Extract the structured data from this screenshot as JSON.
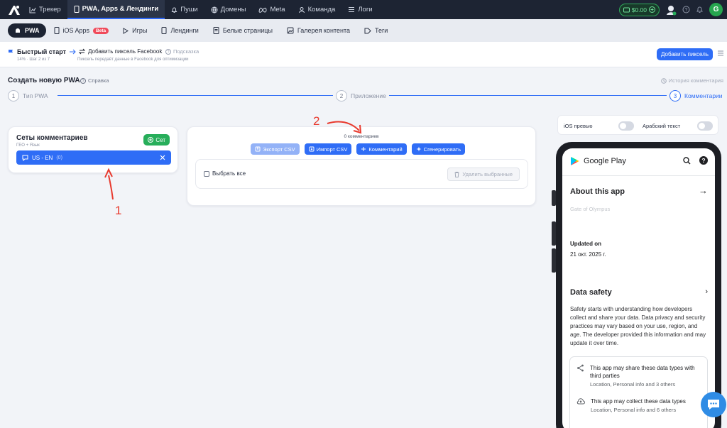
{
  "topnav": {
    "items": [
      {
        "label": "Трекер"
      },
      {
        "label": "PWA, Apps & Лендинги"
      },
      {
        "label": "Пуши"
      },
      {
        "label": "Домены"
      },
      {
        "label": "Meta"
      },
      {
        "label": "Команда"
      },
      {
        "label": "Логи"
      }
    ],
    "balance": "$0.00",
    "avatar_letter": "G"
  },
  "subnav": {
    "items": [
      {
        "label": "PWA"
      },
      {
        "label": "iOS Apps",
        "badge": "Beta"
      },
      {
        "label": "Игры"
      },
      {
        "label": "Лендинги"
      },
      {
        "label": "Белые страницы"
      },
      {
        "label": "Галерея контента"
      },
      {
        "label": "Теги"
      }
    ]
  },
  "quickstart": {
    "title": "Быстрый старт",
    "progress": "14% · Шаг 2 из 7",
    "step_label": "Добавить пиксель Facebook",
    "step_desc": "Пиксель передаёт данные в Facebook для оптимизации",
    "hint": "Подсказка",
    "action": "Добавить пиксель"
  },
  "page": {
    "title": "Создать новую PWA",
    "help": "Справка",
    "history": "История комментария"
  },
  "wizard": {
    "steps": [
      {
        "num": "1",
        "label": "Тип PWA"
      },
      {
        "num": "2",
        "label": "Приложение"
      },
      {
        "num": "3",
        "label": "Комментарии"
      }
    ]
  },
  "sets": {
    "title": "Сеты комментариев",
    "subtitle": "ГЕО + Язык",
    "add_button": "Сет",
    "items": [
      {
        "label": "US - EN",
        "count": "(0)"
      }
    ]
  },
  "comments": {
    "count_text": "0 комментариев",
    "export": "Экспорт CSV",
    "import": "Импорт CSV",
    "add": "Комментарий",
    "generate": "Сгенерировать",
    "select_all": "Выбрать все",
    "delete_selected": "Удалить выбранные"
  },
  "annotations": {
    "one": "1",
    "two": "2"
  },
  "preview": {
    "ios_label": "iOS превью",
    "ios_on": false,
    "arabic_label": "Арабский текст",
    "arabic_on": false
  },
  "phone": {
    "store": "Google Play",
    "about": "About this app",
    "app_name": "Gate of Olympus",
    "updated_label": "Updated on",
    "updated_date": "21 окт. 2025 г.",
    "data_safety_title": "Data safety",
    "data_safety_text": "Safety starts with understanding how developers collect and share your data. Data privacy and security practices may vary based on your use, region, and age. The developer provided this information and may update it over time.",
    "items": [
      {
        "title": "This app may share these data types with third parties",
        "sub": "Location, Personal info and 3 others"
      },
      {
        "title": "This app may collect these data types",
        "sub": "Location, Personal info and 6 others"
      }
    ]
  },
  "colors": {
    "accent": "#2f6df6",
    "green": "#27ae5a",
    "dark": "#1d2433",
    "annotation": "#e83a2e"
  }
}
